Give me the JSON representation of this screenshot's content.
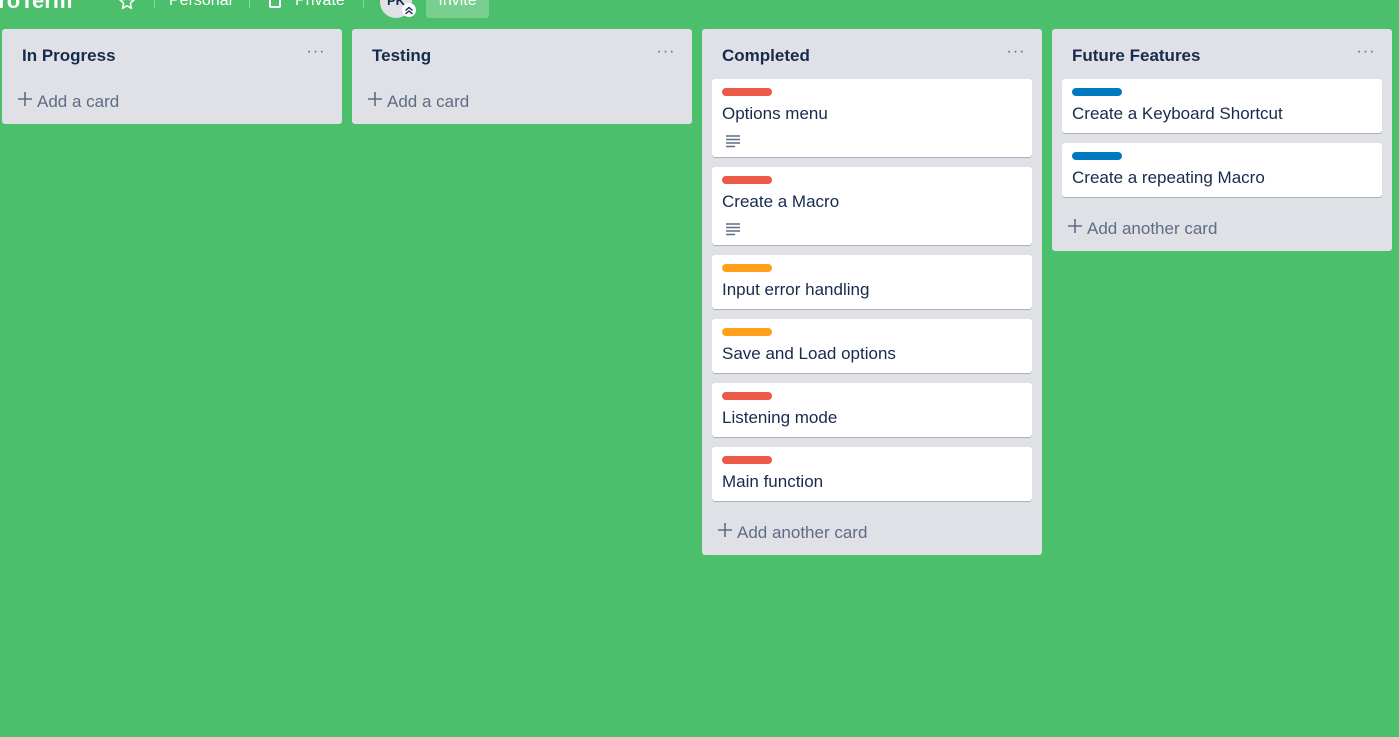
{
  "header": {
    "board_title": "croTerm",
    "star_icon": "star-icon",
    "team_label": "Personal",
    "visibility_icon": "lock-icon",
    "visibility_label": "Private",
    "avatar_initials": "PK",
    "invite_label": "Invite"
  },
  "colors": {
    "board_background": "#4bbf6b",
    "list_background": "#dfe1e6",
    "label_red": "#eb5a46",
    "label_orange": "#ff9f1a",
    "label_blue": "#0079bf"
  },
  "lists": [
    {
      "title": "In Progress",
      "menu_label": "···",
      "cards": [],
      "add_label": "Add a card"
    },
    {
      "title": "Testing",
      "menu_label": "···",
      "cards": [],
      "add_label": "Add a card"
    },
    {
      "title": "Completed",
      "menu_label": "···",
      "cards": [
        {
          "label_color": "red",
          "title": "Options menu",
          "has_description": true
        },
        {
          "label_color": "red",
          "title": "Create a Macro",
          "has_description": true
        },
        {
          "label_color": "orange",
          "title": "Input error handling",
          "has_description": false
        },
        {
          "label_color": "orange",
          "title": "Save and Load options",
          "has_description": false
        },
        {
          "label_color": "red",
          "title": "Listening mode",
          "has_description": false
        },
        {
          "label_color": "red",
          "title": "Main function",
          "has_description": false
        }
      ],
      "add_label": "Add another card"
    },
    {
      "title": "Future Features",
      "menu_label": "···",
      "cards": [
        {
          "label_color": "blue",
          "title": "Create a Keyboard Shortcut",
          "has_description": false
        },
        {
          "label_color": "blue",
          "title": "Create a repeating Macro",
          "has_description": false
        }
      ],
      "add_label": "Add another card"
    }
  ]
}
